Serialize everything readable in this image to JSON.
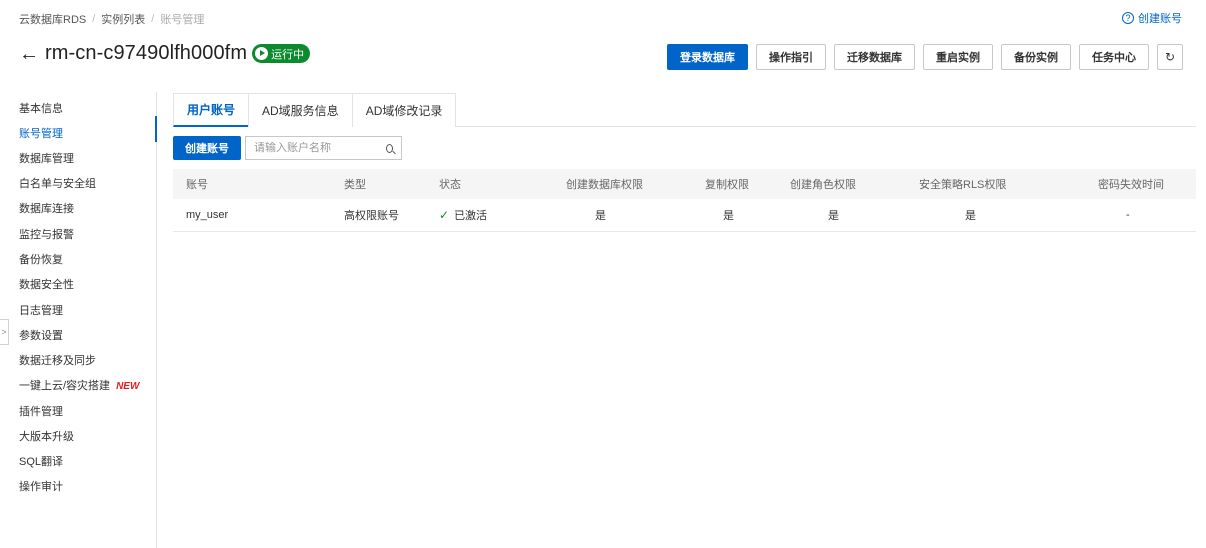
{
  "breadcrumb": [
    "云数据库RDS",
    "实例列表",
    "账号管理"
  ],
  "help_link": "创建账号",
  "header": {
    "title": "rm-cn-c97490lfh000fm",
    "status": "运行中",
    "status_color": "#0b8a2e"
  },
  "actions": {
    "login_db": "登录数据库",
    "guide": "操作指引",
    "migrate": "迁移数据库",
    "restart": "重启实例",
    "backup": "备份实例",
    "tasks": "任务中心",
    "refresh_icon": "refresh-icon"
  },
  "sidebar": {
    "items": [
      {
        "label": "基本信息"
      },
      {
        "label": "账号管理",
        "active": true
      },
      {
        "label": "数据库管理"
      },
      {
        "label": "白名单与安全组"
      },
      {
        "label": "数据库连接"
      },
      {
        "label": "监控与报警"
      },
      {
        "label": "备份恢复"
      },
      {
        "label": "数据安全性"
      },
      {
        "label": "日志管理"
      },
      {
        "label": "参数设置"
      },
      {
        "label": "数据迁移及同步"
      },
      {
        "label": "一键上云/容灾搭建",
        "badge": "NEW"
      },
      {
        "label": "插件管理"
      },
      {
        "label": "大版本升级"
      },
      {
        "label": "SQL翻译"
      },
      {
        "label": "操作审计"
      }
    ]
  },
  "tabs": [
    {
      "label": "用户账号",
      "active": true
    },
    {
      "label": "AD域服务信息"
    },
    {
      "label": "AD域修改记录"
    }
  ],
  "toolbar": {
    "create_label": "创建账号",
    "search_placeholder": "请输入账户名称"
  },
  "table": {
    "headers": [
      "账号",
      "类型",
      "状态",
      "创建数据库权限",
      "复制权限",
      "创建角色权限",
      "安全策略RLS权限",
      "密码失效时间"
    ],
    "rows": [
      [
        "my_user",
        "高权限账号",
        "已激活",
        "是",
        "是",
        "是",
        "是",
        "-"
      ]
    ]
  },
  "colors": {
    "accent": "#0064c8",
    "new_badge": "#e02020"
  }
}
